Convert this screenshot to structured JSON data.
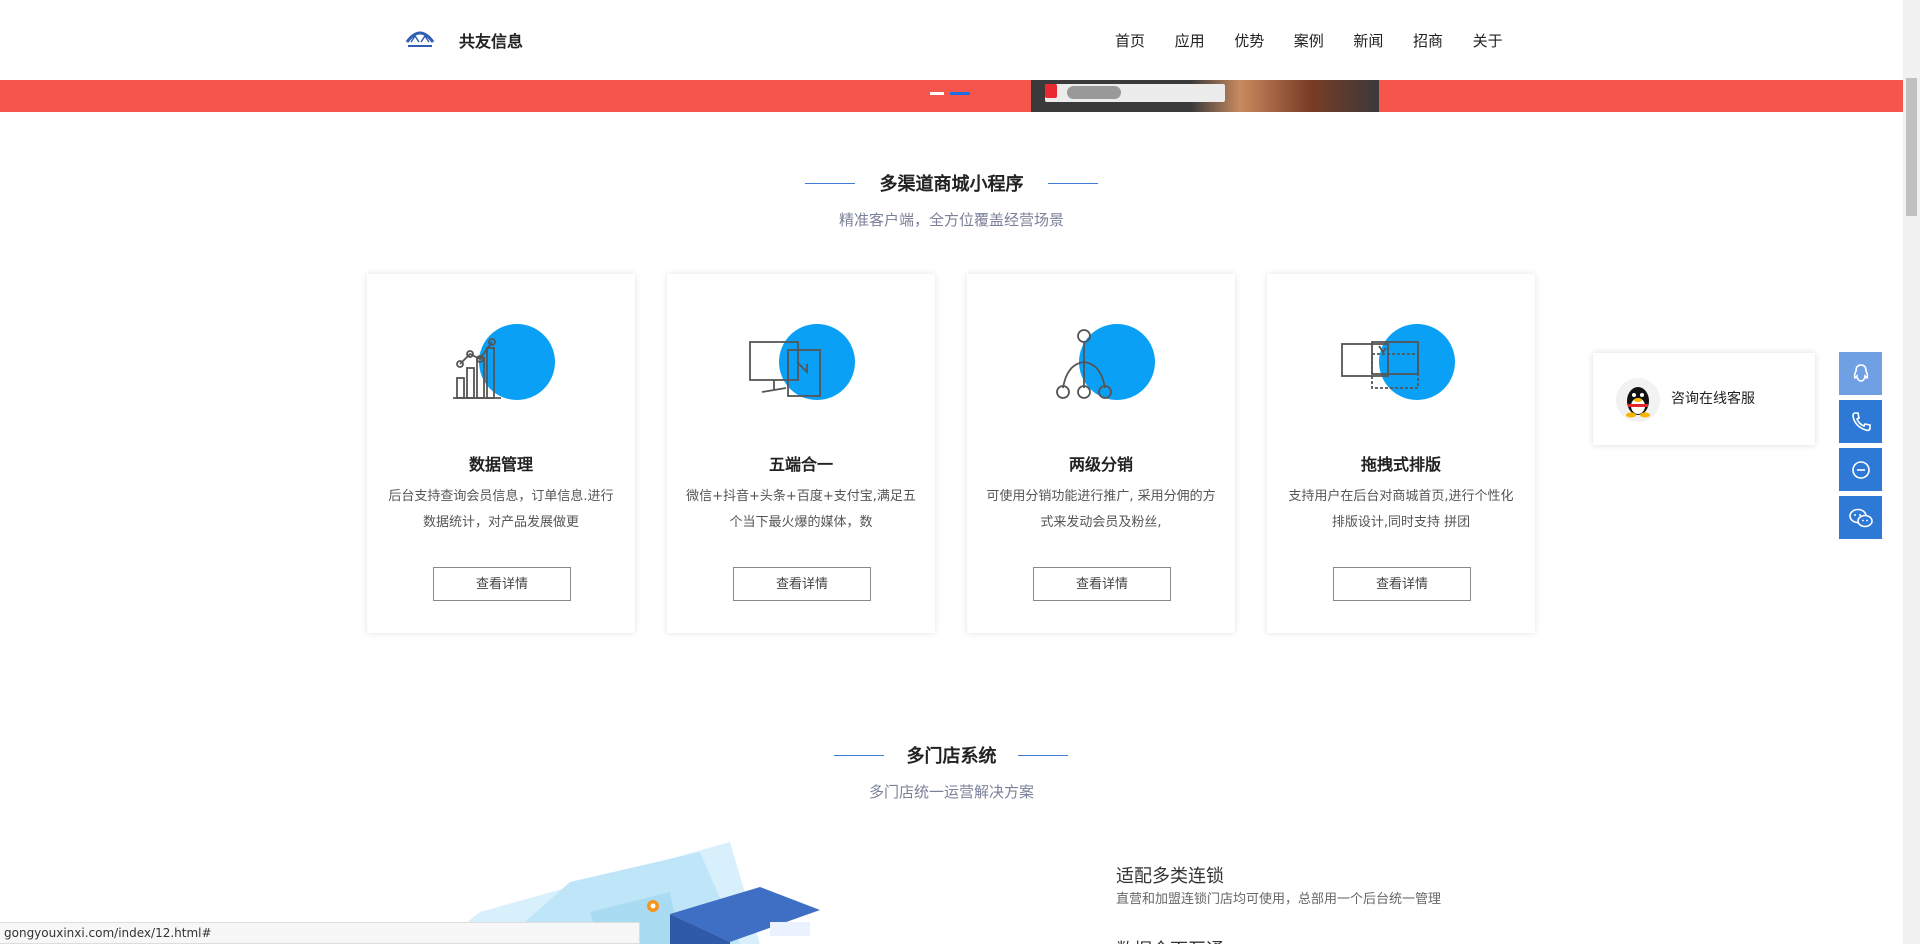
{
  "header": {
    "brand": "共友信息",
    "nav": [
      "首页",
      "应用",
      "优势",
      "案例",
      "新闻",
      "招商",
      "关于"
    ]
  },
  "section1": {
    "title": "多渠道商城小程序",
    "subtitle": "精准客户端，全方位覆盖经营场景",
    "cards": [
      {
        "title": "数据管理",
        "desc": "后台支持查询会员信息，订单信息.进行数据统计，对产品发展做更",
        "button": "查看详情",
        "icon": "chart-icon"
      },
      {
        "title": "五端合一",
        "desc": "微信+抖音+头条+百度+支付宝,满足五个当下最火爆的媒体，数",
        "button": "查看详情",
        "icon": "monitor-icon"
      },
      {
        "title": "两级分销",
        "desc": "可使用分销功能进行推广, 采用分佣的方式来发动会员及粉丝,",
        "button": "查看详情",
        "icon": "network-icon"
      },
      {
        "title": "拖拽式排版",
        "desc": "支持用户在后台对商城首页,进行个性化排版设计,同时支持 拼团",
        "button": "查看详情",
        "icon": "drag-layout-icon"
      }
    ]
  },
  "section2": {
    "title": "多门店系统",
    "subtitle": "多门店统一运营解决方案",
    "feature_title": "适配多类连锁",
    "feature_desc": "直营和加盟连锁门店均可使用，总部用一个后台统一管理",
    "next_feature_title": "数据全面互通"
  },
  "float": {
    "consult_text": "咨询在线客服"
  },
  "status_url": "gongyouxinxi.com/index/12.html#",
  "colors": {
    "accent_blue": "#0aa0f5",
    "banner_red": "#f6554b",
    "float_blue": "#2f79d6"
  }
}
